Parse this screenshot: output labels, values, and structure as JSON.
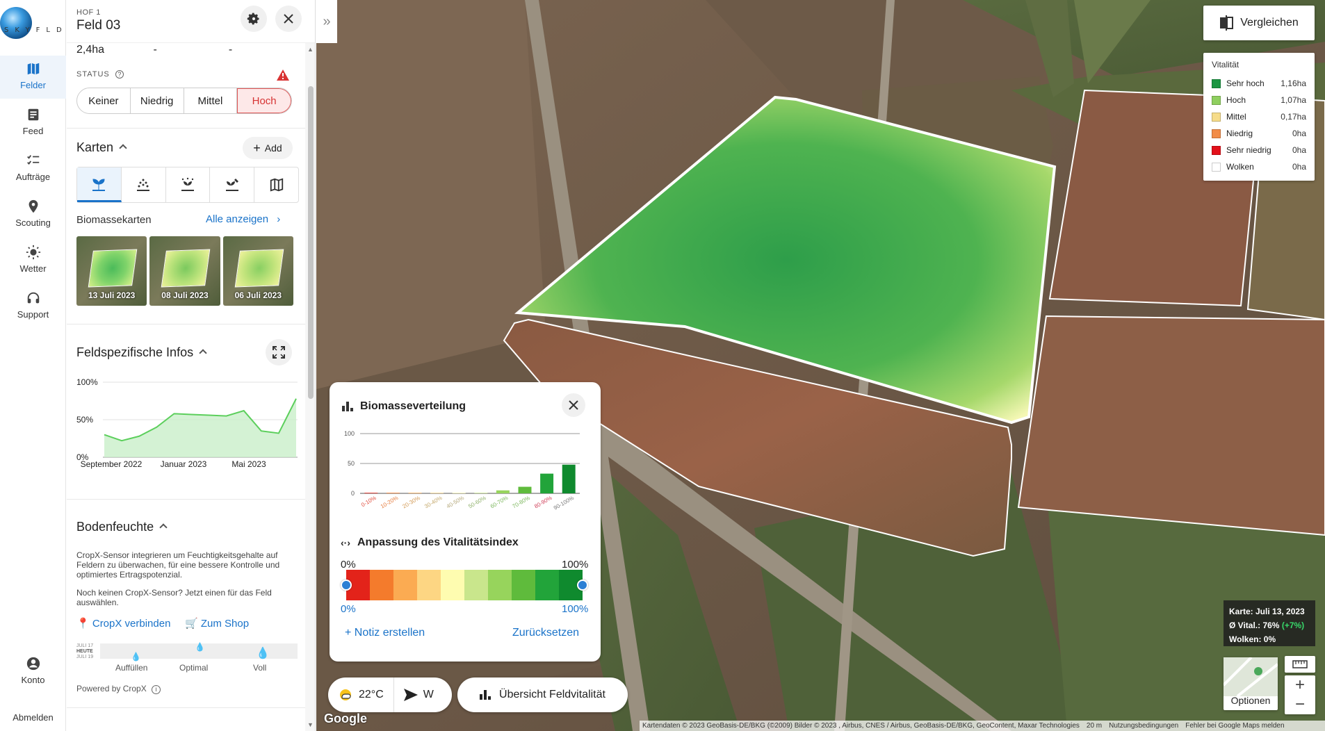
{
  "app": {
    "logo_text": "SKYFLD"
  },
  "nav": {
    "items": [
      {
        "label": "Felder",
        "icon": "map-icon",
        "active": true
      },
      {
        "label": "Feed",
        "icon": "feed-icon"
      },
      {
        "label": "Aufträge",
        "icon": "checklist-icon"
      },
      {
        "label": "Scouting",
        "icon": "pin-icon"
      },
      {
        "label": "Wetter",
        "icon": "sun-icon"
      },
      {
        "label": "Support",
        "icon": "headset-icon"
      },
      {
        "label": "Konto",
        "icon": "account-icon"
      }
    ],
    "logout": "Abmelden"
  },
  "panel": {
    "farm": "HOF 1",
    "field": "Feld 03",
    "area": "2,4ha",
    "area_col2": "-",
    "area_col3": "-",
    "status_label": "STATUS",
    "status_options": [
      "Keiner",
      "Niedrig",
      "Mittel",
      "Hoch"
    ],
    "status_selected": "Hoch",
    "maps_title": "Karten",
    "add_label": "Add",
    "biomass_label": "Biomassekarten",
    "show_all": "Alle anzeigen",
    "thumbs": [
      "13 Juli 2023",
      "08 Juli 2023",
      "06 Juli 2023"
    ],
    "field_info_title": "Feldspezifische Infos",
    "chart_y_labels": [
      "100%",
      "50%",
      "0%"
    ],
    "chart_x_labels": [
      "September 2022",
      "Januar 2023",
      "Mai 2023"
    ],
    "soil_title": "Bodenfeuchte",
    "soil_text1": "CropX-Sensor integrieren um Feuchtigkeitsgehalte auf Feldern zu überwachen, für eine bessere Kontrolle und optimiertes Ertragspotenzial.",
    "soil_text2": "Noch keinen CropX-Sensor? Jetzt einen für das Feld auswählen.",
    "cropx_connect": "CropX verbinden",
    "to_shop": "Zum Shop",
    "moist_labels": [
      "Auffüllen",
      "Optimal",
      "Voll"
    ],
    "moist_dates": [
      "JULI 17",
      "HEUTE",
      "JULI 19"
    ],
    "powered": "Powered by CropX"
  },
  "map": {
    "compare": "Vergleichen",
    "legend_title": "Vitalität",
    "legend": [
      {
        "name": "Sehr hoch",
        "value": "1,16ha",
        "color": "#1a9641"
      },
      {
        "name": "Hoch",
        "value": "1,07ha",
        "color": "#8fcf5f"
      },
      {
        "name": "Mittel",
        "value": "0,17ha",
        "color": "#f6dc8a"
      },
      {
        "name": "Niedrig",
        "value": "0ha",
        "color": "#f28c48"
      },
      {
        "name": "Sehr niedrig",
        "value": "0ha",
        "color": "#e3101a"
      },
      {
        "name": "Wolken",
        "value": "0ha",
        "color": "#ffffff"
      }
    ],
    "popup": {
      "title": "Biomasseverteilung",
      "y_ticks": [
        "100",
        "50",
        "0"
      ],
      "vi_title": "Anpassung des Vitalitätsindex",
      "top_left": "0%",
      "top_right": "100%",
      "bottom_left": "0%",
      "bottom_right": "100%",
      "ramp_colors": [
        "#e3231a",
        "#f47b2c",
        "#fbab52",
        "#fdd683",
        "#fefcb0",
        "#c9e68c",
        "#97d45c",
        "#5fbb3c",
        "#22a43a",
        "#0f8a2e"
      ],
      "note": "+ Notiz erstellen",
      "reset": "Zurücksetzen"
    },
    "weather_temp": "22°C",
    "weather_wind": "W",
    "overview": "Übersicht Feldvitalität",
    "info_line1": "Karte: Juli 13, 2023",
    "info_line2_prefix": "Ø Vital.: 76%",
    "info_line2_delta": "(+7%)",
    "info_line3": "Wolken: 0%",
    "options": "Optionen",
    "google": "Google",
    "attribution": "Kartendaten © 2023 GeoBasis-DE/BKG (©2009) Bilder © 2023 , Airbus, CNES / Airbus, GeoBasis-DE/BKG, GeoContent, Maxar Technologies",
    "scale": "20 m",
    "terms": "Nutzungsbedingungen",
    "report": "Fehler bei Google Maps melden"
  },
  "chart_data": [
    {
      "type": "bar",
      "title": "Biomasseverteilung",
      "categories": [
        "0-10%",
        "10-20%",
        "20-30%",
        "30-40%",
        "40-50%",
        "50-60%",
        "60-70%",
        "70-80%",
        "80-90%",
        "90-100%"
      ],
      "values": [
        0,
        0,
        0,
        0,
        0,
        0,
        5,
        11,
        33,
        48
      ],
      "ylim": [
        0,
        100
      ],
      "xlabel": "",
      "ylabel": ""
    },
    {
      "type": "area",
      "title": "",
      "x": [
        "2022-08",
        "2022-09",
        "2022-10",
        "2022-11",
        "2022-12",
        "2023-01",
        "2023-02",
        "2023-03",
        "2023-04",
        "2023-05",
        "2023-06",
        "2023-07"
      ],
      "values": [
        30,
        22,
        28,
        40,
        58,
        57,
        56,
        55,
        62,
        35,
        32,
        78
      ],
      "ylim": [
        0,
        100
      ],
      "xlabel": "",
      "ylabel": ""
    }
  ]
}
